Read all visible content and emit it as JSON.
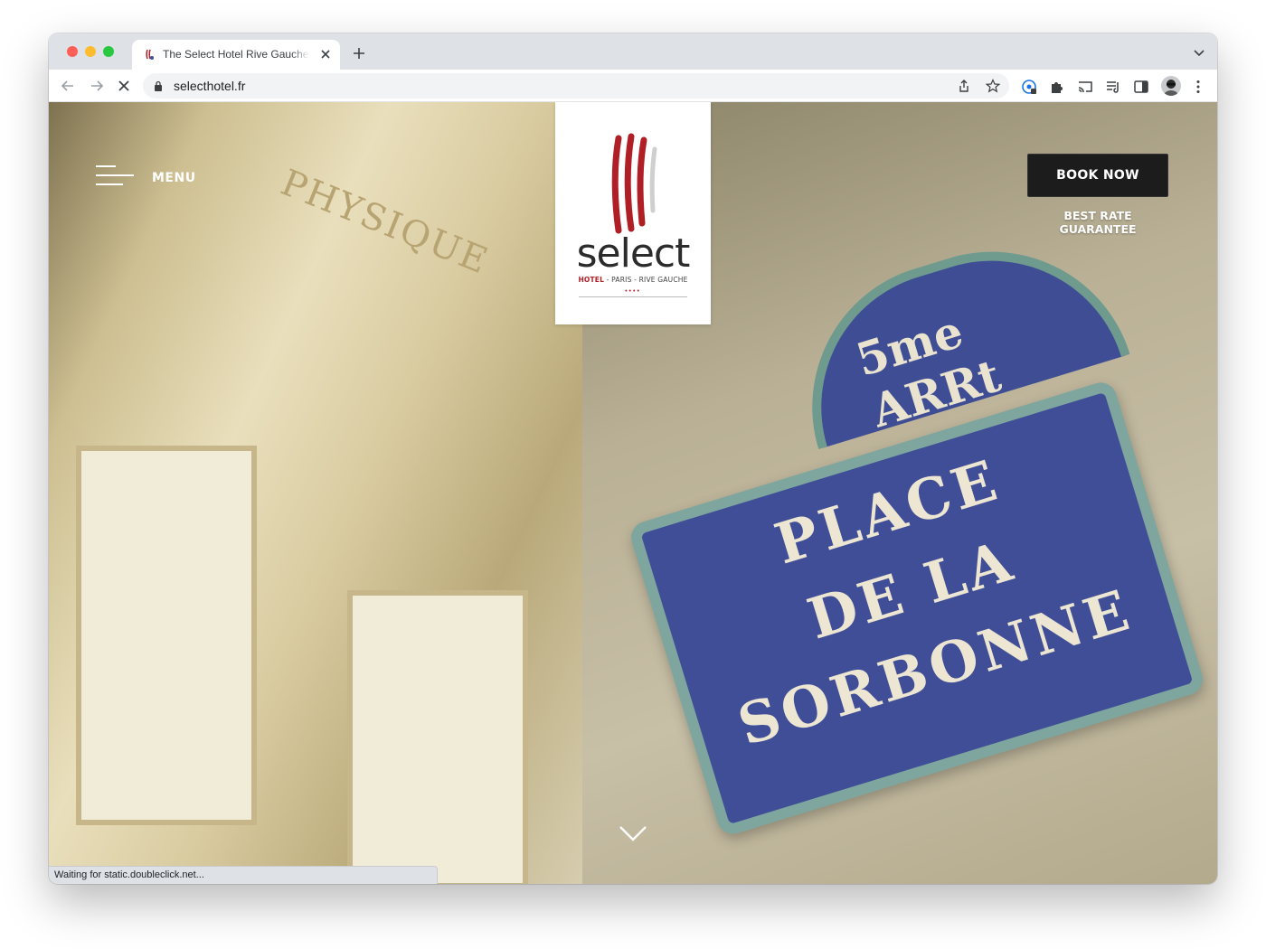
{
  "browser": {
    "tab": {
      "title": "The Select Hotel Rive Gauche | Paris"
    },
    "address_bar": {
      "url": "selecthotel.fr"
    },
    "status_text": "Waiting for static.doubleclick.net..."
  },
  "site": {
    "menu_label": "MENU",
    "logo": {
      "name": "select",
      "tagline_hotel": "HOTEL",
      "tagline_rest": " - PARIS - RIVE GAUCHE",
      "stars": "••••"
    },
    "book_button": "BOOK NOW",
    "rate_guarantee": "BEST RATE GUARANTEE"
  },
  "hero": {
    "sign": {
      "arrondissement": "5me ARRt",
      "line1": "PLACE",
      "line2": "DE LA",
      "line3": "SORBONNE"
    },
    "facade_inscription": "PHYSIQUE"
  },
  "colors": {
    "brand_red": "#b01f25",
    "button_dark": "#1c1c1c",
    "sign_blue": "#3f4e96"
  }
}
